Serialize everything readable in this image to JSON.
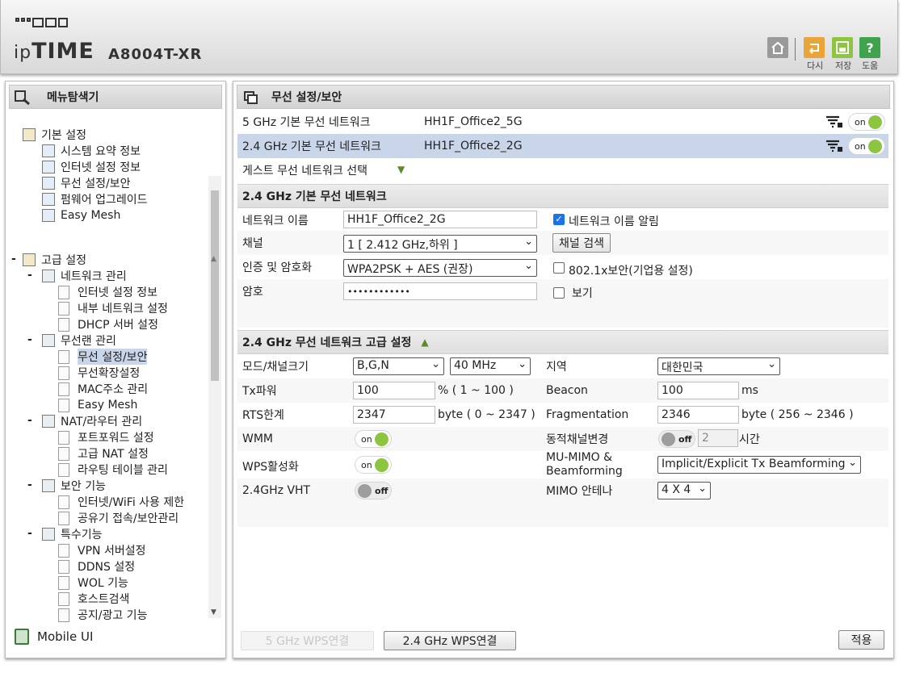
{
  "header": {
    "brand_ip": "ip",
    "brand_time": "TIME",
    "model": "A8004T-XR",
    "home_label": "",
    "retry_label": "다시",
    "save_label": "저장",
    "help_label": "도움"
  },
  "sidebar": {
    "title": "메뉴탐색기",
    "basic": {
      "label": "기본 설정",
      "items": [
        "시스템 요약 정보",
        "인터넷 설정 정보",
        "무선 설정/보안",
        "펌웨어 업그레이드",
        "Easy Mesh"
      ]
    },
    "advanced": {
      "label": "고급 설정",
      "groups": [
        {
          "label": "네트워크 관리",
          "items": [
            "인터넷 설정 정보",
            "내부 네트워크 설정",
            "DHCP 서버 설정"
          ]
        },
        {
          "label": "무선랜 관리",
          "items": [
            "무선 설정/보안",
            "무선확장설정",
            "MAC주소 관리",
            "Easy Mesh"
          ]
        },
        {
          "label": "NAT/라우터 관리",
          "items": [
            "포트포워드 설정",
            "고급 NAT 설정",
            "라우팅 테이블 관리"
          ]
        },
        {
          "label": "보안 기능",
          "items": [
            "인터넷/WiFi 사용 제한",
            "공유기 접속/보안관리"
          ]
        },
        {
          "label": "특수기능",
          "items": [
            "VPN 서버설정",
            "DDNS 설정",
            "WOL 기능",
            "호스트검색",
            "공지/광고 기능"
          ]
        }
      ]
    },
    "mobile": "Mobile UI"
  },
  "main": {
    "title": "무선 설정/보안",
    "networks": [
      {
        "label": "5 GHz 기본 무선 네트워크",
        "ssid": "HH1F_Office2_5G",
        "toggle": "on"
      },
      {
        "label": "2.4 GHz 기본 무선 네트워크",
        "ssid": "HH1F_Office2_2G",
        "toggle": "on"
      }
    ],
    "guest": "게스트 무선 네트워크 선택",
    "basic": {
      "title": "2.4 GHz 기본 무선 네트워크",
      "name_label": "네트워크 이름",
      "name_value": "HH1F_Office2_2G",
      "broadcast_label": "네트워크 이름 알림",
      "channel_label": "채널",
      "channel_value": "1 [ 2.412 GHz,하위 ]",
      "scan_label": "채널 검색",
      "auth_label": "인증 및 암호화",
      "auth_value": "WPA2PSK + AES (권장)",
      "dot1x_label": "802.1x보안(기업용 설정)",
      "pw_label": "암호",
      "pw_value": "••••••••••••",
      "show_label": "보기"
    },
    "adv": {
      "title": "2.4 GHz 무선 네트워크 고급 설정",
      "mode_label": "모드/채널크기",
      "mode_value": "B,G,N",
      "width_value": "40 MHz",
      "region_label": "지역",
      "region_value": "대한민국",
      "tx_label": "Tx파워",
      "tx_value": "100",
      "tx_unit": "% ( 1 ~ 100 )",
      "beacon_label": "Beacon",
      "beacon_value": "100",
      "beacon_unit": "ms",
      "rts_label": "RTS한계",
      "rts_value": "2347",
      "rts_unit": "byte ( 0 ~ 2347 )",
      "frag_label": "Fragmentation",
      "frag_value": "2346",
      "frag_unit": "byte ( 256 ~ 2346 )",
      "wmm_label": "WMM",
      "wmm_toggle": "on",
      "dyn_label": "동적채널변경",
      "dyn_toggle": "off",
      "dyn_value": "2",
      "dyn_unit": "시간",
      "wps_label": "WPS활성화",
      "wps_toggle": "on",
      "mumimo_label": "MU-MIMO & Beamforming",
      "mumimo_value": "Implicit/Explicit Tx Beamforming",
      "vht_label": "2.4GHz VHT",
      "vht_toggle": "off",
      "mimo_label": "MIMO 안테나",
      "mimo_value": "4 X 4"
    },
    "buttons": {
      "wps5": "5 GHz WPS연결",
      "wps24": "2.4 GHz WPS연결",
      "apply": "적용"
    }
  },
  "colors": {
    "selected_row": "#c9d6ea",
    "toggle_on": "#8cc540",
    "header_bg": "#d9d9d9"
  }
}
